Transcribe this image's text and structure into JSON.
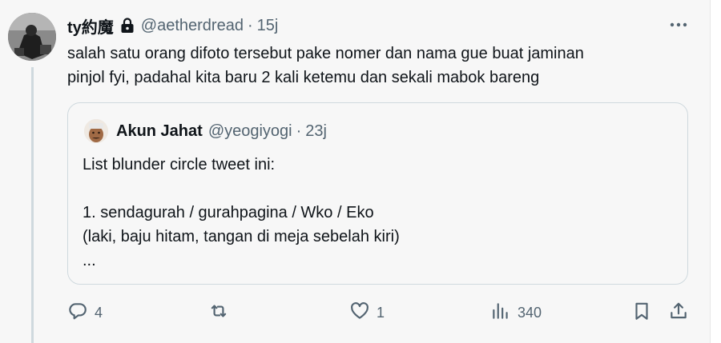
{
  "tweet": {
    "display_name": "ty約魔",
    "handle": "@aetherdread",
    "separator": "·",
    "time": "15j",
    "text_line1": "salah satu orang difoto tersebut pake nomer dan nama gue buat jaminan",
    "text_line2": "pinjol fyi, padahal kita baru 2 kali ketemu dan sekali mabok bareng",
    "icons": [
      "lock-icon",
      "more-icon"
    ]
  },
  "quote": {
    "display_name": "Akun Jahat",
    "handle": "@yeogiyogi",
    "separator": "·",
    "time": "23j",
    "lines": [
      "List blunder circle tweet ini:",
      "",
      "1. sendagurah / gurahpagina / Wko / Eko",
      "(laki, baju hitam, tangan di meja sebelah kiri)",
      "..."
    ]
  },
  "actions": {
    "reply_count": "4",
    "retweet_count": "",
    "like_count": "1",
    "views_count": "340",
    "icons": [
      "reply-icon",
      "retweet-icon",
      "like-icon",
      "views-icon",
      "bookmark-icon",
      "share-icon"
    ]
  },
  "colors": {
    "text": "#0f1419",
    "secondary": "#536471",
    "border": "#cfd9de",
    "background": "#f7f7f7"
  }
}
